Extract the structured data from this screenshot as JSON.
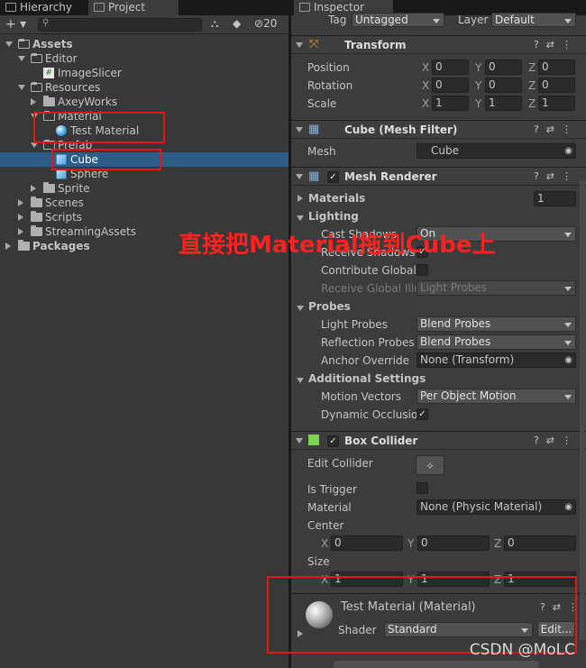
{
  "tabs": {
    "hierarchy": "Hierarchy",
    "project": "Project",
    "inspector": "Inspector"
  },
  "toolbar": {
    "add": "+ ▾",
    "search_placeholder": "",
    "hidden_count": "20"
  },
  "tree": [
    {
      "label": "Assets",
      "indent": 0,
      "arrow": "down",
      "folder": "open",
      "bold": true
    },
    {
      "label": "Editor",
      "indent": 1,
      "arrow": "down",
      "folder": "open"
    },
    {
      "label": "ImageSlicer",
      "indent": 2,
      "arrow": "none",
      "icon": "script"
    },
    {
      "label": "Resources",
      "indent": 1,
      "arrow": "down",
      "folder": "open"
    },
    {
      "label": "AxeyWorks",
      "indent": 2,
      "arrow": "right",
      "folder": "closed"
    },
    {
      "label": "Material",
      "indent": 2,
      "arrow": "down",
      "folder": "open"
    },
    {
      "label": "Test Material",
      "indent": 3,
      "arrow": "none",
      "icon": "material"
    },
    {
      "label": "Prefab",
      "indent": 2,
      "arrow": "down",
      "folder": "open"
    },
    {
      "label": "Cube",
      "indent": 3,
      "arrow": "none",
      "icon": "prefab",
      "selected": true
    },
    {
      "label": "Sphere",
      "indent": 3,
      "arrow": "none",
      "icon": "prefab"
    },
    {
      "label": "Sprite",
      "indent": 2,
      "arrow": "right",
      "folder": "closed"
    },
    {
      "label": "Scenes",
      "indent": 1,
      "arrow": "right",
      "folder": "closed"
    },
    {
      "label": "Scripts",
      "indent": 1,
      "arrow": "right",
      "folder": "closed"
    },
    {
      "label": "StreamingAssets",
      "indent": 1,
      "arrow": "right",
      "folder": "closed"
    },
    {
      "label": "Packages",
      "indent": 0,
      "arrow": "right",
      "folder": "closed",
      "bold": true
    }
  ],
  "inspector": {
    "tag_label": "Tag",
    "tag_value": "Untagged",
    "layer_label": "Layer",
    "layer_value": "Default",
    "transform": {
      "title": "Transform",
      "rows": [
        {
          "label": "Position",
          "x": "0",
          "y": "0",
          "z": "0"
        },
        {
          "label": "Rotation",
          "x": "0",
          "y": "0",
          "z": "0"
        },
        {
          "label": "Scale",
          "x": "1",
          "y": "1",
          "z": "1"
        }
      ]
    },
    "mesh_filter": {
      "title": "Cube (Mesh Filter)",
      "mesh_label": "Mesh",
      "mesh_value": "Cube"
    },
    "mesh_renderer": {
      "title": "Mesh Renderer",
      "materials_label": "Materials",
      "materials_count": "1",
      "lighting_label": "Lighting",
      "cast_shadows_label": "Cast Shadows",
      "cast_shadows_value": "On",
      "receive_shadows_label": "Receive Shadows",
      "contribute_gi_label": "Contribute Global I",
      "receive_gi_label": "Receive Global Illu",
      "receive_gi_value": "Light Probes",
      "probes_label": "Probes",
      "light_probes_label": "Light Probes",
      "light_probes_value": "Blend Probes",
      "reflection_probes_label": "Reflection Probes",
      "reflection_probes_value": "Blend Probes",
      "anchor_override_label": "Anchor Override",
      "anchor_override_value": "None (Transform)",
      "additional_label": "Additional Settings",
      "motion_vectors_label": "Motion Vectors",
      "motion_vectors_value": "Per Object Motion",
      "dynamic_occlusion_label": "Dynamic Occlusio"
    },
    "box_collider": {
      "title": "Box Collider",
      "edit_collider_label": "Edit Collider",
      "is_trigger_label": "Is Trigger",
      "material_label": "Material",
      "material_value": "None (Physic Material)",
      "center_label": "Center",
      "center": {
        "x": "0",
        "y": "0",
        "z": "0"
      },
      "size_label": "Size",
      "size": {
        "x": "1",
        "y": "1",
        "z": "1"
      }
    },
    "material": {
      "title": "Test Material (Material)",
      "shader_label": "Shader",
      "shader_value": "Standard",
      "edit_label": "Edit..."
    }
  },
  "annotation": "直接把Material拖到Cube上",
  "watermark": "CSDN @MoLC",
  "colors": {
    "selection": "#2c5d87",
    "annotation": "#ff2020"
  }
}
